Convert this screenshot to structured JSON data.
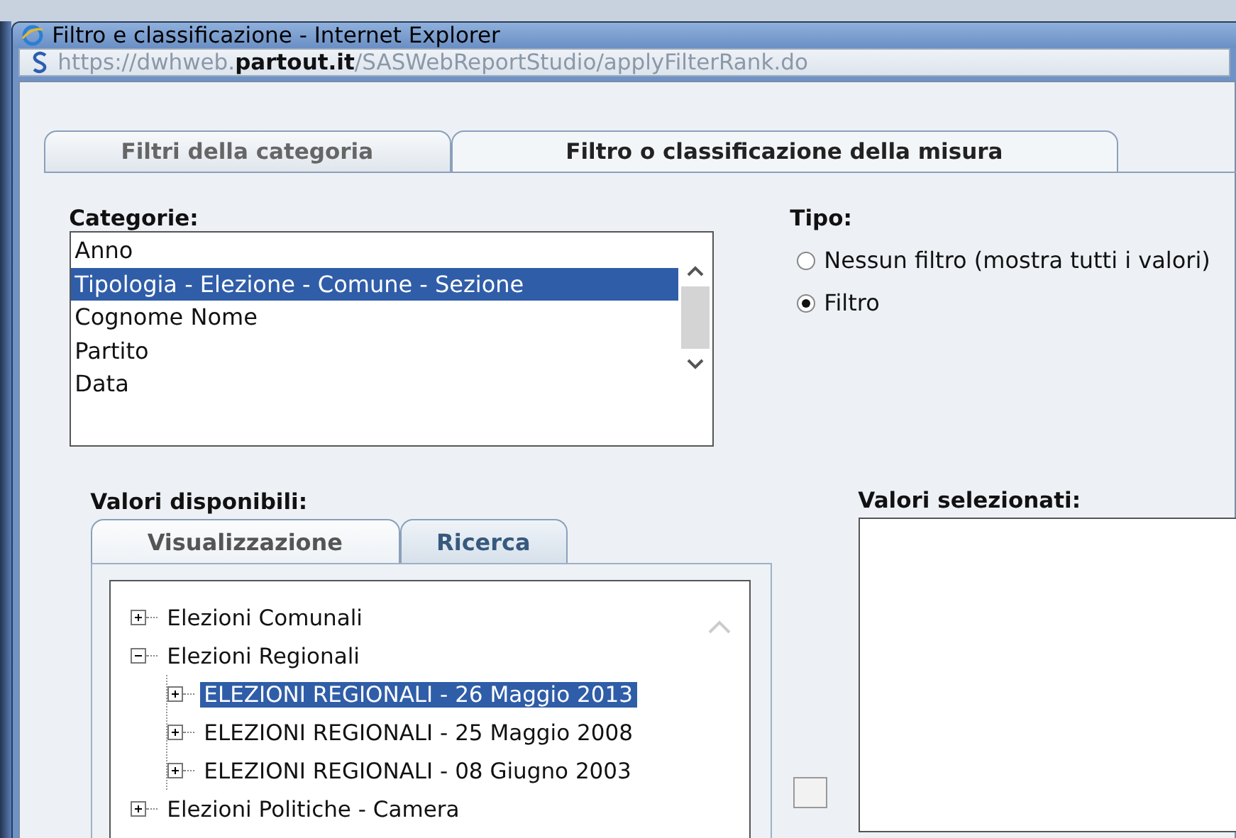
{
  "window": {
    "title": "Filtro e classificazione - Internet Explorer",
    "address": "https://dwhweb.**partout.it**/SASWebReportStudio/applyFilterRank.do"
  },
  "tabs": [
    {
      "label": "Filtri della categoria",
      "selected": false
    },
    {
      "label": "Filtro o classificazione della misura",
      "selected": true
    }
  ],
  "categories": {
    "label": "Categorie:",
    "items": [
      {
        "label": "Anno",
        "selected": false
      },
      {
        "label": "Tipologia - Elezione - Comune - Sezione",
        "selected": true
      },
      {
        "label": "Cognome Nome",
        "selected": false
      },
      {
        "label": "Partito",
        "selected": false
      },
      {
        "label": "Data",
        "selected": false
      }
    ]
  },
  "type": {
    "label": "Tipo:",
    "options": [
      {
        "label": "Nessun filtro (mostra tutti i valori)",
        "selected": false
      },
      {
        "label": "Filtro",
        "selected": true
      }
    ]
  },
  "available_values": {
    "label": "Valori disponibili:",
    "tabs": [
      {
        "label": "Visualizzazione",
        "selected": true
      },
      {
        "label": "Ricerca",
        "selected": false
      }
    ],
    "tree": [
      {
        "label": "Elezioni Comunali",
        "expanded": false,
        "selected": false
      },
      {
        "label": "Elezioni Regionali",
        "expanded": true,
        "selected": false,
        "children": [
          {
            "label": "ELEZIONI REGIONALI - 26 Maggio 2013",
            "expanded": false,
            "selected": true
          },
          {
            "label": "ELEZIONI REGIONALI - 25 Maggio 2008",
            "expanded": false,
            "selected": false
          },
          {
            "label": "ELEZIONI REGIONALI - 08 Giugno 2003",
            "expanded": false,
            "selected": false
          }
        ]
      },
      {
        "label": "Elezioni Politiche - Camera",
        "expanded": false,
        "selected": false
      }
    ]
  },
  "selected_values": {
    "label": "Valori selezionati:"
  }
}
